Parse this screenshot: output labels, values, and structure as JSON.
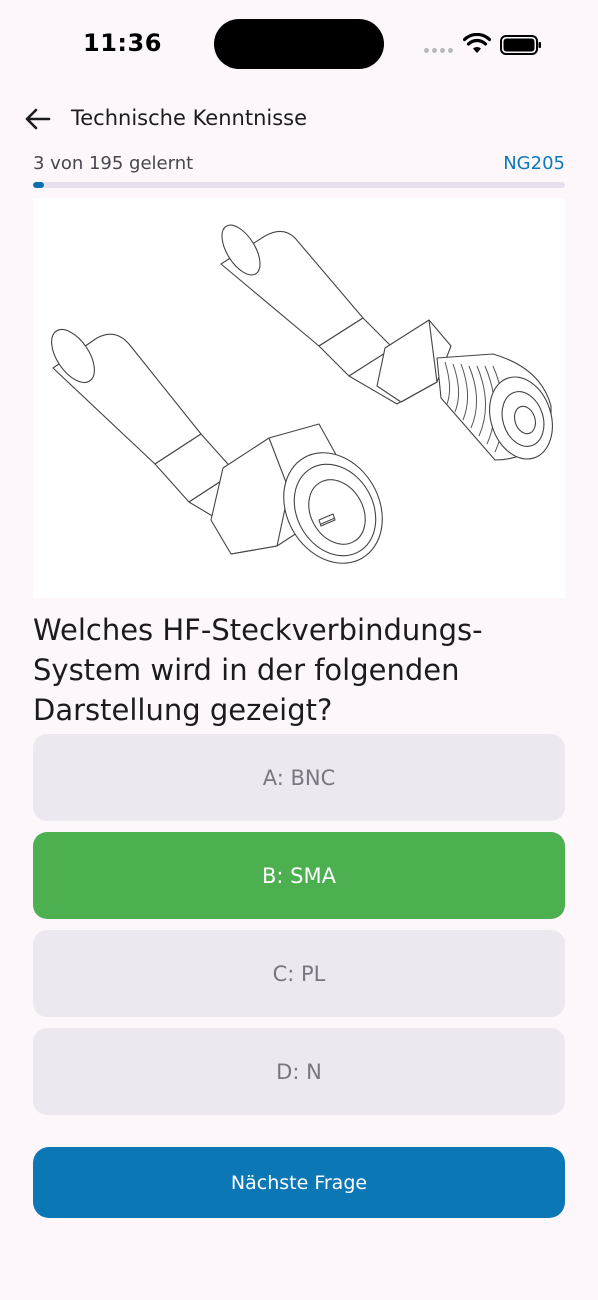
{
  "status_bar": {
    "time": "11:36"
  },
  "header": {
    "back_icon": "arrow-left-icon",
    "title": "Technische Kenntnisse"
  },
  "progress": {
    "label": "3 von 195 gelernt",
    "question_id": "NG205",
    "learned": 3,
    "total": 195
  },
  "illustration": {
    "description_icon": "connector-illustration"
  },
  "question": {
    "text": "Welches HF-Steckverbindungs-System wird in der folgenden Darstellung gezeigt?"
  },
  "answers": [
    {
      "label": "A: BNC",
      "state": "neutral"
    },
    {
      "label": "B: SMA",
      "state": "correct"
    },
    {
      "label": "C: PL",
      "state": "neutral"
    },
    {
      "label": "D: N",
      "state": "neutral"
    }
  ],
  "next_button": {
    "label": "Nächste Frage"
  },
  "colors": {
    "background": "#fdf7fc",
    "accent": "#0b77b5",
    "correct": "#4caf50",
    "answer_neutral": "#ede7f0"
  }
}
